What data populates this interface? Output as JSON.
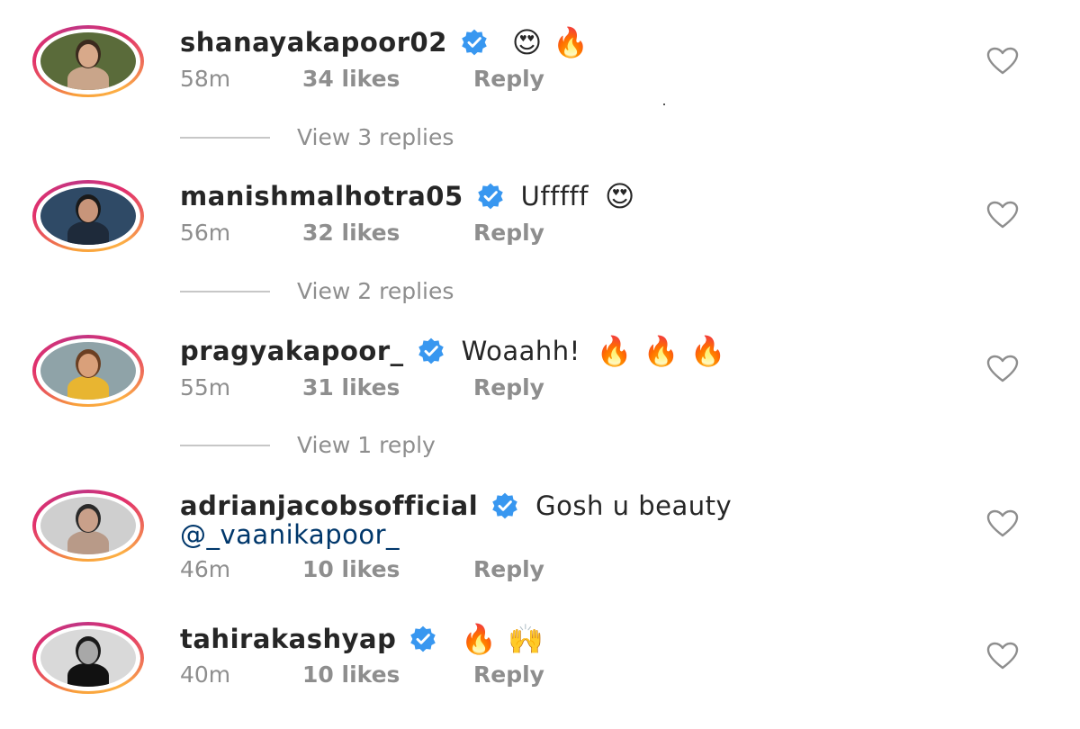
{
  "comments": [
    {
      "username": "shanayakapoor02",
      "text": "",
      "emojis": [
        "😍",
        "🔥"
      ],
      "time": "58m",
      "likes": "34 likes",
      "reply": "Reply",
      "view_replies": "View 3 replies",
      "avatar_colors": {
        "bg": "#5a6b3a",
        "skin": "#d8a98a",
        "hair": "#3b2a1e",
        "top": "#c9a58a"
      }
    },
    {
      "username": "manishmalhotra05",
      "text": "Ufffff",
      "emojis": [
        "😍"
      ],
      "time": "56m",
      "likes": "32 likes",
      "reply": "Reply",
      "view_replies": "View 2 replies",
      "avatar_colors": {
        "bg": "#2f4a66",
        "skin": "#c8957a",
        "hair": "#1a1a1a",
        "top": "#1e2a3a"
      }
    },
    {
      "username": "pragyakapoor_",
      "text": "Woaahh!",
      "emojis": [
        "🔥",
        "🔥",
        "🔥"
      ],
      "time": "55m",
      "likes": "31 likes",
      "reply": "Reply",
      "view_replies": "View 1 reply",
      "avatar_colors": {
        "bg": "#8fa3a8",
        "skin": "#d9a07a",
        "hair": "#6b3f22",
        "top": "#e8b531"
      }
    },
    {
      "username": "adrianjacobsofficial",
      "text": "Gosh u beauty",
      "mention": "@_vaanikapoor_",
      "emojis": [],
      "time": "46m",
      "likes": "10 likes",
      "reply": "Reply",
      "avatar_colors": {
        "bg": "#cfcfcf",
        "skin": "#c9a08a",
        "hair": "#2a2a2a",
        "top": "#b89a88"
      }
    },
    {
      "username": "tahirakashyap",
      "text": "",
      "emojis": [
        "🔥",
        "🙌"
      ],
      "time": "40m",
      "likes": "10 likes",
      "reply": "Reply",
      "avatar_colors": {
        "bg": "#d9d9d9",
        "skin": "#a8a8a8",
        "hair": "#1a1a1a",
        "top": "#111111"
      }
    }
  ],
  "icons": {
    "verified": "verified-badge-icon",
    "like": "heart-outline-icon"
  },
  "colors": {
    "verified_blue": "#3897f0",
    "meta_gray": "#8e8e8e",
    "mention_blue": "#00376b"
  }
}
